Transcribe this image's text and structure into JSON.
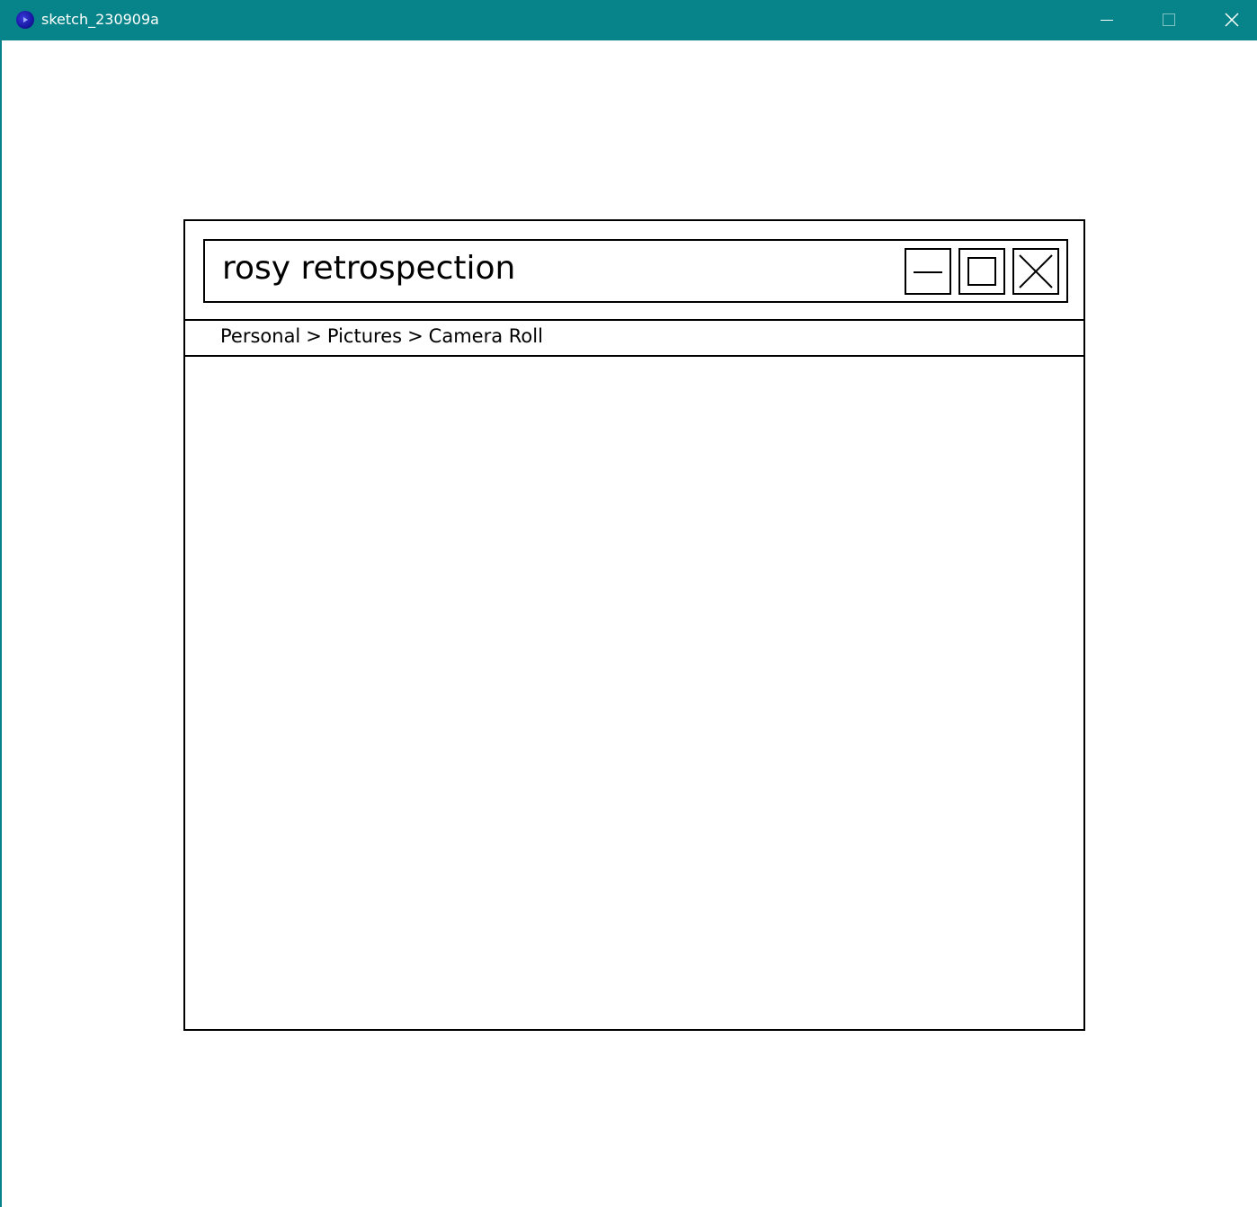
{
  "os_window": {
    "title": "sketch_230909a",
    "accent": "#07848a",
    "icon": "processing-app-icon",
    "controls": [
      "minimize-icon",
      "maximize-icon",
      "close-icon"
    ]
  },
  "sketch": {
    "title": "rosy retrospection",
    "buttons": [
      "minimize-icon",
      "maximize-icon",
      "close-icon"
    ],
    "breadcrumb": {
      "items": [
        "Personal",
        "Pictures",
        "Camera Roll"
      ],
      "separator": ">"
    }
  }
}
